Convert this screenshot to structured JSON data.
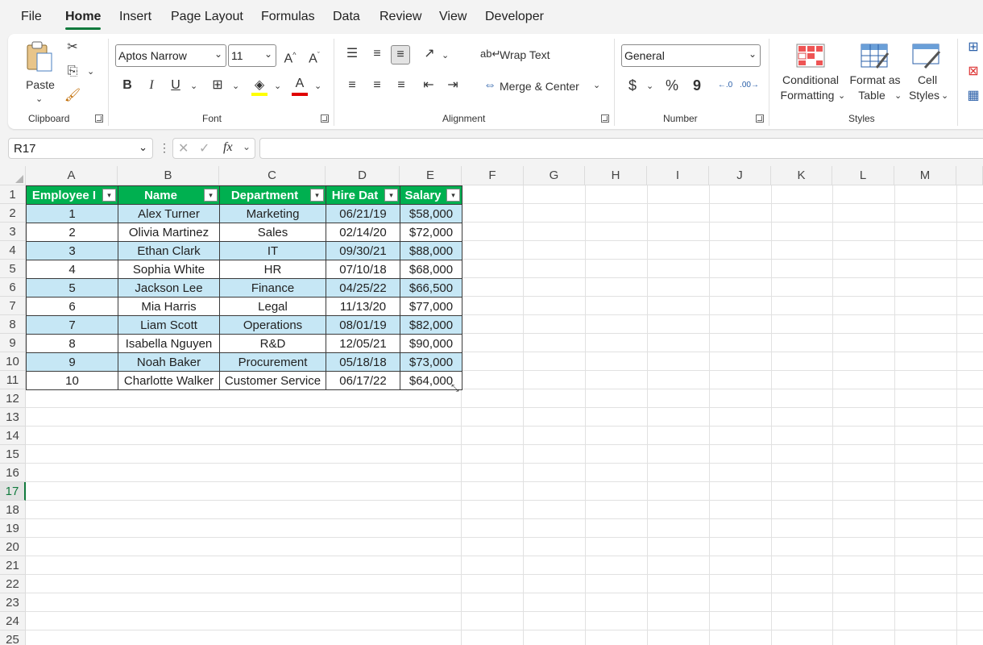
{
  "menu": {
    "tabs": [
      "File",
      "Home",
      "Insert",
      "Page Layout",
      "Formulas",
      "Data",
      "Review",
      "View",
      "Developer"
    ],
    "active": "Home"
  },
  "ribbon": {
    "clipboard": {
      "paste_label": "Paste",
      "group_label": "Clipboard"
    },
    "font": {
      "font_name": "Aptos Narrow",
      "font_size": "11",
      "group_label": "Font",
      "bold": "B",
      "italic": "I",
      "underline": "U",
      "highlight_color": "#ffff00",
      "font_color": "#e00000"
    },
    "alignment": {
      "wrap_text": "Wrap Text",
      "merge_center": "Merge & Center",
      "group_label": "Alignment"
    },
    "number": {
      "format": "General",
      "group_label": "Number",
      "currency": "$",
      "percent": "%",
      "comma": "9"
    },
    "styles": {
      "conditional_line1": "Conditional",
      "conditional_line2": "Formatting",
      "format_table_line1": "Format as",
      "format_table_line2": "Table",
      "cell_styles_line1": "Cell",
      "cell_styles_line2": "Styles",
      "group_label": "Styles"
    }
  },
  "formula_bar": {
    "name_box": "R17",
    "fx": "fx",
    "value": ""
  },
  "sheet": {
    "columns": [
      "A",
      "B",
      "C",
      "D",
      "E",
      "F",
      "G",
      "H",
      "I",
      "J",
      "K",
      "L",
      "M"
    ],
    "rows": [
      "1",
      "2",
      "3",
      "4",
      "5",
      "6",
      "7",
      "8",
      "9",
      "10",
      "11",
      "12",
      "13",
      "14",
      "15",
      "16",
      "17",
      "18",
      "19",
      "20",
      "21",
      "22",
      "23",
      "24",
      "25"
    ],
    "selected_row": "17",
    "header_color": "#00b050",
    "band_color": "#c6e7f5",
    "table": {
      "headers": [
        "Employee I",
        "Name",
        "Department",
        "Hire Dat",
        "Salary"
      ],
      "rows": [
        [
          "1",
          "Alex Turner",
          "Marketing",
          "06/21/19",
          "$58,000"
        ],
        [
          "2",
          "Olivia Martinez",
          "Sales",
          "02/14/20",
          "$72,000"
        ],
        [
          "3",
          "Ethan Clark",
          "IT",
          "09/30/21",
          "$88,000"
        ],
        [
          "4",
          "Sophia White",
          "HR",
          "07/10/18",
          "$68,000"
        ],
        [
          "5",
          "Jackson Lee",
          "Finance",
          "04/25/22",
          "$66,500"
        ],
        [
          "6",
          "Mia Harris",
          "Legal",
          "11/13/20",
          "$77,000"
        ],
        [
          "7",
          "Liam Scott",
          "Operations",
          "08/01/19",
          "$82,000"
        ],
        [
          "8",
          "Isabella Nguyen",
          "R&D",
          "12/05/21",
          "$90,000"
        ],
        [
          "9",
          "Noah Baker",
          "Procurement",
          "05/18/18",
          "$73,000"
        ],
        [
          "10",
          "Charlotte Walker",
          "Customer Service",
          "06/17/22",
          "$64,000"
        ]
      ]
    }
  }
}
